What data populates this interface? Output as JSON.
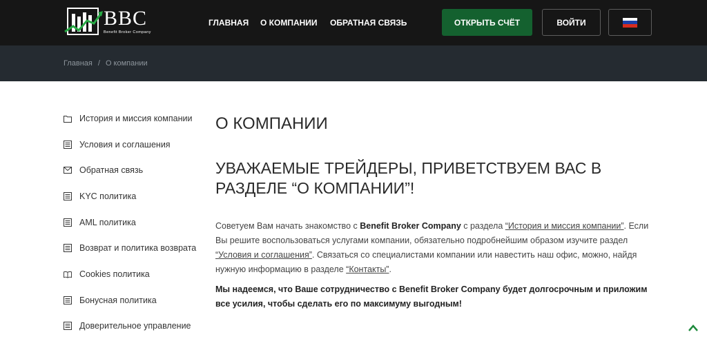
{
  "header": {
    "logo_text": "BBC",
    "logo_subtitle": "Benefit Broker Company",
    "nav": [
      {
        "label": "ГЛАВНАЯ"
      },
      {
        "label": "О КОМПАНИИ"
      },
      {
        "label": "ОБРАТНАЯ СВЯЗЬ"
      }
    ],
    "open_account_label": "ОТКРЫТЬ СЧЁТ",
    "login_label": "ВОЙТИ",
    "language_flag": "russia-flag-icon"
  },
  "breadcrumb": {
    "home": "Главная",
    "separator": "/",
    "current": "О компании"
  },
  "sidebar": {
    "items": [
      {
        "label": "История и миссия компании",
        "icon": "folder-icon"
      },
      {
        "label": "Условия и соглашения",
        "icon": "document-list-icon"
      },
      {
        "label": "Обратная связь",
        "icon": "envelope-icon"
      },
      {
        "label": "KYC политика",
        "icon": "document-list-icon"
      },
      {
        "label": "AML политика",
        "icon": "document-list-icon"
      },
      {
        "label": "Возврат и политика возврата",
        "icon": "document-list-icon"
      },
      {
        "label": "Cookies политика",
        "icon": "book-icon"
      },
      {
        "label": "Бонусная политика",
        "icon": "document-list-icon"
      },
      {
        "label": "Доверительное управление",
        "icon": "document-list-icon"
      }
    ]
  },
  "main": {
    "title": "О КОМПАНИИ",
    "welcome": "УВАЖАЕМЫЕ ТРЕЙДЕРЫ, ПРИВЕТСТВУЕМ ВАС В РАЗДЕЛЕ “О КОМПАНИИ”!",
    "paragraph": {
      "p1": "Советуем Вам начать знакомство с ",
      "company": "Benefit Broker Company",
      "p2": " с раздела ",
      "link_history": "“История и миссия компании”",
      "p3": ". Если Вы решите воспользоваться услугами компании, обязательно подробнейшим образом изучите раздел ",
      "link_terms": "“Условия и соглашения”",
      "p4": ". Связаться со специалистами компании или навестить наш офис, можно, найдя нужную информацию в разделе ",
      "link_contacts": "“Контакты”",
      "p5": "."
    },
    "closing": "Мы надеемся, что Ваше сотрудничество с Benefit Broker Company будет долгосрочным и приложим все усилия, чтобы сделать его по максимуму выгодным!"
  },
  "colors": {
    "header_bg": "#161616",
    "breadcrumb_bg": "#252b31",
    "accent_green": "#14612f",
    "scroll_arrow": "#1e8a3c"
  }
}
